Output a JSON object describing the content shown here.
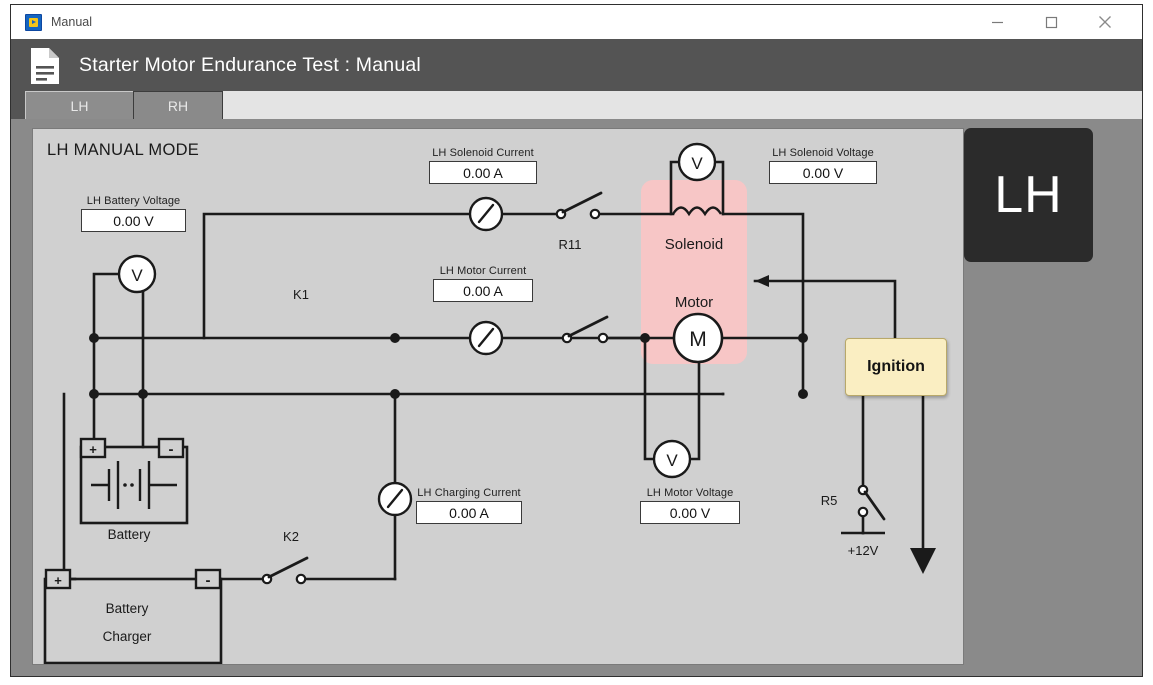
{
  "window": {
    "title": "Manual",
    "app_icon": "labview-icon",
    "controls": {
      "minimize": "minimize-icon",
      "maximize": "maximize-icon",
      "close": "close-icon"
    }
  },
  "header": {
    "icon": "document-icon",
    "title": "Starter Motor Endurance Test : Manual"
  },
  "tabs": [
    {
      "label": "LH",
      "selected": true
    },
    {
      "label": "RH",
      "selected": false
    }
  ],
  "panel": {
    "title": "LH MANUAL MODE"
  },
  "badge": {
    "label": "LH"
  },
  "indicators": [
    {
      "name": "lh-battery-voltage",
      "label": "LH Battery Voltage",
      "value": "0.00 V"
    },
    {
      "name": "lh-solenoid-current",
      "label": "LH Solenoid Current",
      "value": "0.00 A"
    },
    {
      "name": "lh-solenoid-voltage",
      "label": "LH Solenoid Voltage",
      "value": "0.00 V"
    },
    {
      "name": "lh-motor-current",
      "label": "LH Motor Current",
      "value": "0.00 A"
    },
    {
      "name": "lh-charging-current",
      "label": "LH Charging Current",
      "value": "0.00 A"
    },
    {
      "name": "lh-motor-voltage",
      "label": "LH Motor Voltage",
      "value": "0.00 V"
    }
  ],
  "schematic": {
    "block_solenoid_motor": {
      "solenoid_label": "Solenoid",
      "motor_label": "Motor",
      "motor_symbol": "M",
      "fill_color": "#f7c6c6"
    },
    "ignition": {
      "label": "Ignition",
      "fill_color": "#faeec2"
    },
    "battery": {
      "label": "Battery",
      "plus_terminal": "+",
      "minus_terminal": "-"
    },
    "battery_charger": {
      "label_line1": "Battery",
      "label_line2": "Charger",
      "plus_terminal": "+",
      "minus_terminal": "-"
    },
    "switches": [
      {
        "name": "K1",
        "label": "K1",
        "state": "open"
      },
      {
        "name": "K2",
        "label": "K2",
        "state": "open"
      },
      {
        "name": "R11",
        "label": "R11",
        "state": "open"
      },
      {
        "name": "R5",
        "label": "R5",
        "state": "open"
      }
    ],
    "supply": {
      "label": "+12V"
    },
    "meters": [
      {
        "name": "battery-voltmeter",
        "symbol": "V"
      },
      {
        "name": "solenoid-voltmeter",
        "symbol": "V"
      },
      {
        "name": "motor-voltmeter",
        "symbol": "V"
      },
      {
        "name": "solenoid-ammeter",
        "symbol": "gauge"
      },
      {
        "name": "motor-ammeter",
        "symbol": "gauge"
      },
      {
        "name": "charging-ammeter",
        "symbol": "gauge"
      }
    ]
  },
  "colors": {
    "header_bar": "#545454",
    "panel_bg": "#d0d0d0",
    "window_bg": "#8a8a8a",
    "badge_bg": "#2b2b2b",
    "wire": "#1a1a1a"
  }
}
